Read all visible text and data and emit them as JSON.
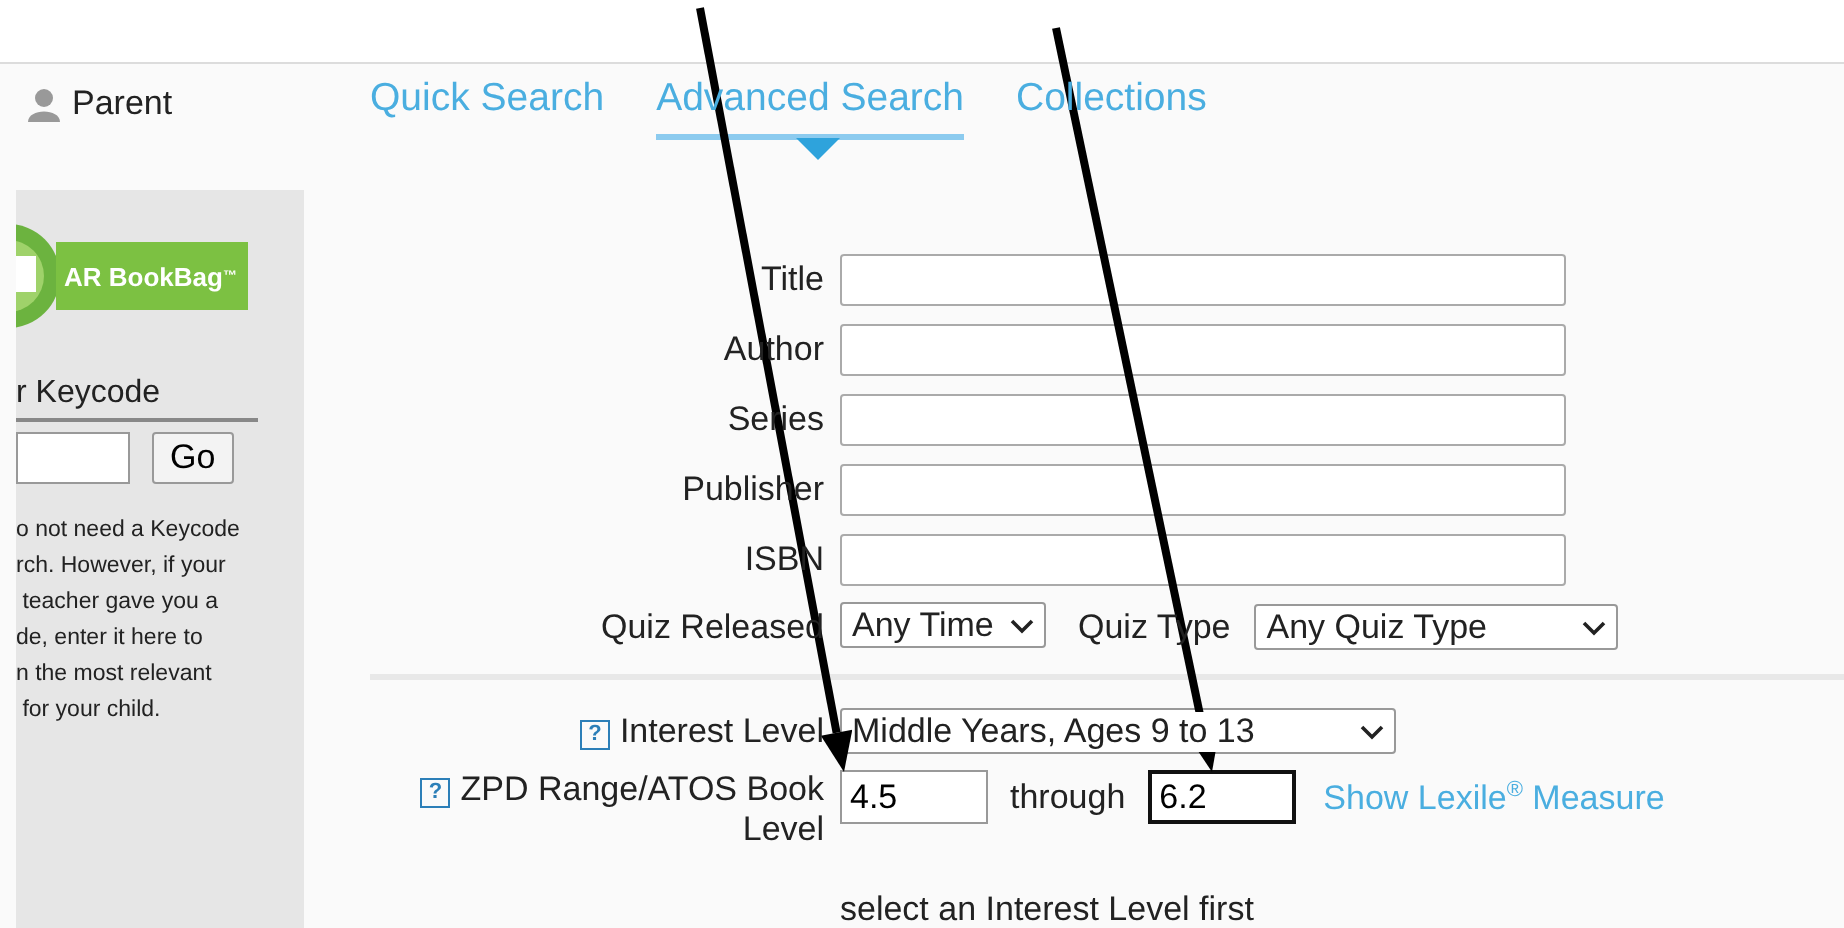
{
  "header": {
    "user": "Parent"
  },
  "tabs": [
    {
      "label": "Quick Search",
      "selected": false
    },
    {
      "label": "Advanced Search",
      "selected": true
    },
    {
      "label": "Collections",
      "selected": false
    }
  ],
  "sidebar": {
    "logo": {
      "name": "AR BookBag",
      "mark": "™"
    },
    "keycode": {
      "heading": "r Keycode",
      "button": "Go"
    },
    "help_lines": [
      "o not need a Keycode",
      "rch. However, if your",
      " teacher gave you a",
      "de, enter it here to",
      "n the most relevant",
      " for your child."
    ]
  },
  "form": {
    "fields": [
      {
        "label": "Title"
      },
      {
        "label": "Author"
      },
      {
        "label": "Series"
      },
      {
        "label": "Publisher"
      },
      {
        "label": "ISBN"
      }
    ],
    "quiz_released": {
      "label": "Quiz Released",
      "value": "Any Time"
    },
    "quiz_type": {
      "label": "Quiz Type",
      "value": "Any Quiz Type"
    }
  },
  "interest_level": {
    "help": "?",
    "label": "Interest Level",
    "value": "Middle Years, Ages 9 to 13"
  },
  "zpd": {
    "help": "?",
    "label": "ZPD Range/ATOS Book Level",
    "from": "4.5",
    "through": "through",
    "to": "6.2",
    "to_focused": true,
    "link": "Show Lexile$^{®}$ Measure",
    "note": "select an Interest Level first"
  },
  "annotations": [
    {
      "kind": "arrow"
    },
    {
      "kind": "arrow"
    }
  ]
}
